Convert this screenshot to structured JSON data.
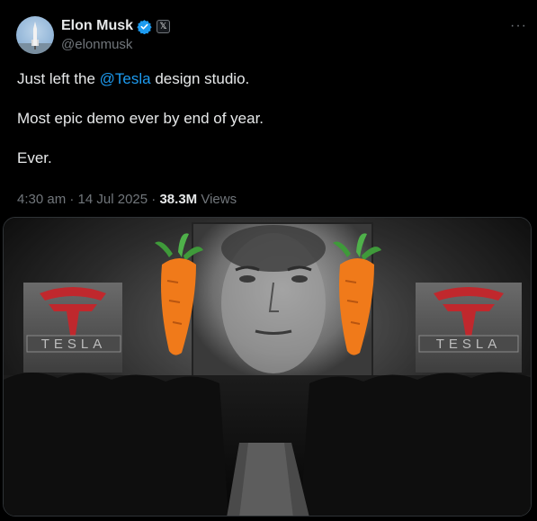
{
  "tweet": {
    "author": {
      "name": "Elon Musk",
      "handle": "@elonmusk",
      "avatar_icon": "rocket-avatar-icon",
      "verified_icon": "verified-badge-icon",
      "affiliate_badge": "𝕏"
    },
    "more_label": "···",
    "text": {
      "line1_prefix": "Just left the ",
      "line1_mention": "@Tesla",
      "line1_suffix": " design studio.",
      "line2": "Most epic demo ever by end of year.",
      "line3": "Ever."
    },
    "meta": {
      "time": "4:30 am",
      "sep1": " · ",
      "date": "14 Jul 2025",
      "sep2": " · ",
      "views_count": "38.3M",
      "views_label": "Views"
    },
    "media": {
      "left_sign_text": "TESLA",
      "right_sign_text": "TESLA",
      "colors": {
        "logo_red": "#c0282d",
        "carrot": "#f07a1a",
        "carrot_top": "#3f9a3a"
      }
    }
  },
  "colors": {
    "accent": "#1d9bf0",
    "muted": "#71767b",
    "text": "#e7e9ea",
    "background": "#000000"
  }
}
